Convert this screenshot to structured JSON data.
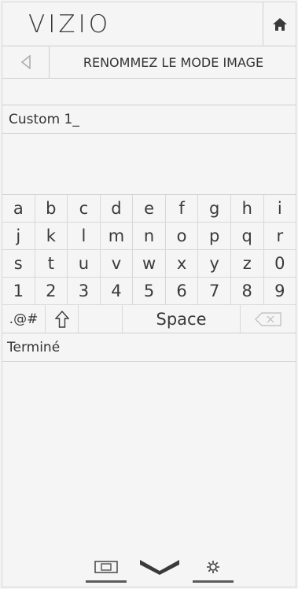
{
  "header": {
    "logo": "VIZIO",
    "home_icon": "home-icon"
  },
  "titlebar": {
    "back_icon": "back-arrow-icon",
    "title": "RENOMMEZ LE MODE IMAGE"
  },
  "name_field": {
    "value": "Custom 1_"
  },
  "keyboard": {
    "rows": [
      [
        "a",
        "b",
        "c",
        "d",
        "e",
        "f",
        "g",
        "h",
        "i"
      ],
      [
        "j",
        "k",
        "l",
        "m",
        "n",
        "o",
        "p",
        "q",
        "r"
      ],
      [
        "s",
        "t",
        "u",
        "v",
        "w",
        "x",
        "y",
        "z",
        "0"
      ],
      [
        "1",
        "2",
        "3",
        "4",
        "5",
        "6",
        "7",
        "8",
        "9"
      ]
    ],
    "symbols_label": ".@#",
    "shift_icon": "shift-arrow-icon",
    "space_label": "Space",
    "backspace_icon": "backspace-icon"
  },
  "done": {
    "label": "Terminé"
  },
  "bottom_bar": {
    "icons": [
      "picture-size-icon",
      "chevron-down-icon",
      "settings-gear-icon"
    ]
  },
  "colors": {
    "background": "#f5f5f5",
    "text": "#333333",
    "divider": "#cfcfcf"
  }
}
